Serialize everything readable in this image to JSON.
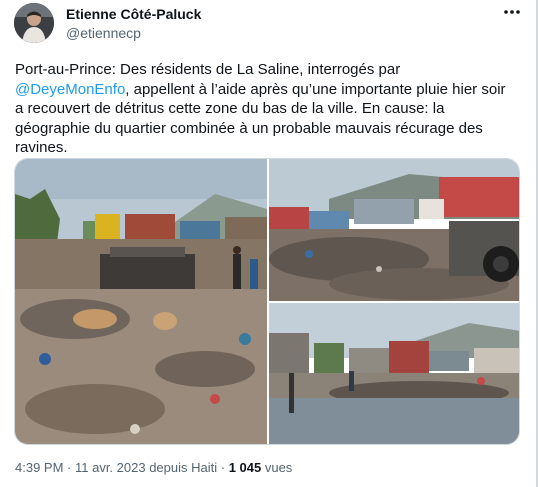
{
  "author": {
    "display_name": "Etienne Côté-Paluck",
    "handle": "@etiennecp",
    "avatar_icon": "profile-photo"
  },
  "more_icon": "more-dots-icon",
  "tweet": {
    "text_before": "Port-au-Prince: Des résidents de La Saline, interrogés par ",
    "mention": "@DeyeMonEnfo",
    "text_after": ", appellent à l’aide après qu’une importante pluie hier soir a recouvert de détritus cette zone du bas de la ville. En cause: la géographie du quartier combinée à un probable mauvais récurage des ravines."
  },
  "media": {
    "photo_count": 3
  },
  "meta": {
    "time": "4:39 PM",
    "separator1": " · ",
    "date": "11 avr. 2023 depuis Haiti",
    "separator2": " · ",
    "views_count": "1 045",
    "views_label": " vues"
  },
  "colors": {
    "link": "#1d9bf0",
    "secondary_text": "#536471",
    "primary_text": "#0f1419"
  }
}
